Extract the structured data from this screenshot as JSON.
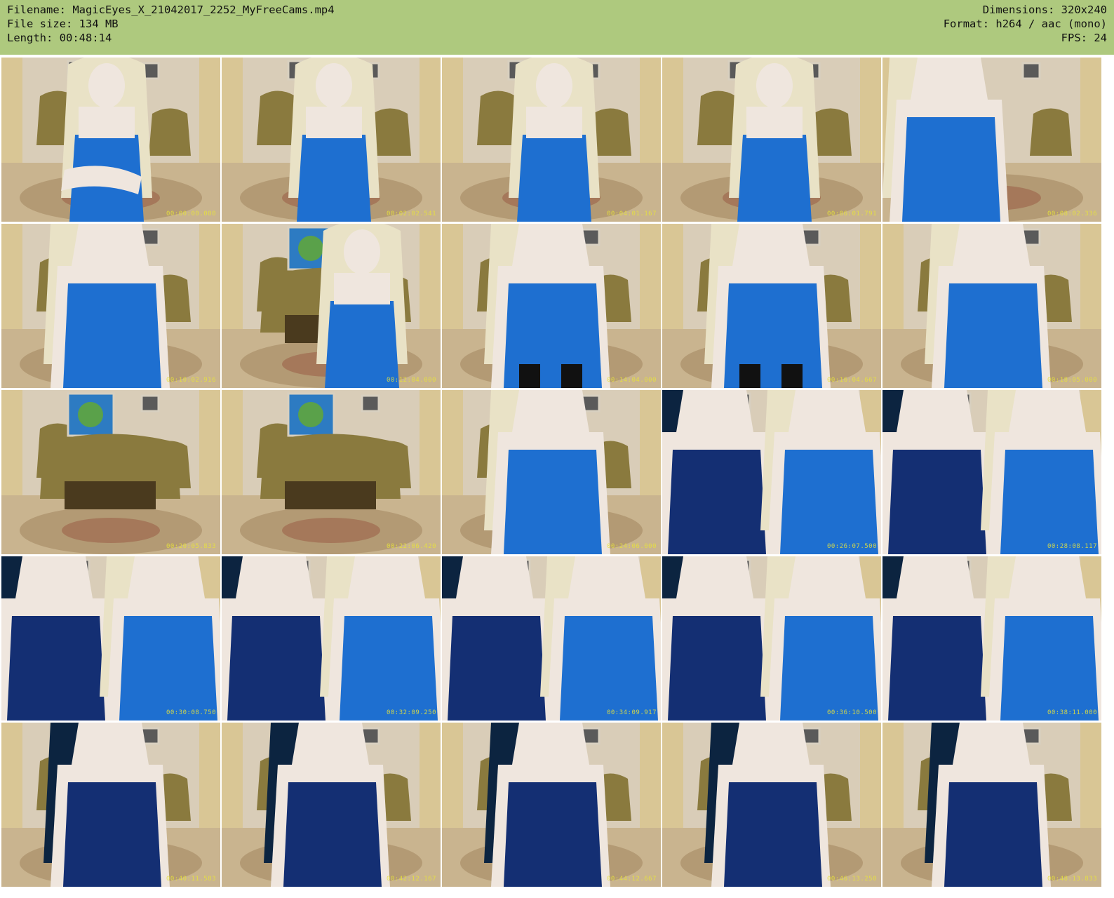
{
  "header": {
    "left": [
      "Filename: MagicEyes_X_21042017_2252_MyFreeCams.mp4",
      "File size: 134 MB",
      "Length: 00:48:14"
    ],
    "right": [
      "Dimensions: 320x240",
      "Format: h264 / aac (mono)",
      "FPS: 24"
    ],
    "background_color": "#aec97e"
  },
  "grid": {
    "columns": 5,
    "rows": 5,
    "frames": [
      {
        "kind": "blonde-arms",
        "timestamp": "00:00:00.000"
      },
      {
        "kind": "blonde",
        "timestamp": "00:02:02.541"
      },
      {
        "kind": "blonde-hair",
        "timestamp": "00:04:01.167"
      },
      {
        "kind": "blonde",
        "timestamp": "00:06:01.791"
      },
      {
        "kind": "blonde-side",
        "timestamp": "00:08:02.336"
      },
      {
        "kind": "blonde-close",
        "timestamp": "00:10:02.916"
      },
      {
        "kind": "blonde-sofa",
        "timestamp": "00:12:04.000"
      },
      {
        "kind": "blonde-stockings",
        "timestamp": "00:14:04.000"
      },
      {
        "kind": "blonde-stockings",
        "timestamp": "00:16:04.667"
      },
      {
        "kind": "blonde-close",
        "timestamp": "00:18:05.000"
      },
      {
        "kind": "empty-room",
        "timestamp": "00:20:05.833"
      },
      {
        "kind": "empty-room",
        "timestamp": "00:22:06.420"
      },
      {
        "kind": "blonde-close",
        "timestamp": "00:24:06.000"
      },
      {
        "kind": "duo",
        "timestamp": "00:26:07.500"
      },
      {
        "kind": "duo",
        "timestamp": "00:28:08.117"
      },
      {
        "kind": "duo",
        "timestamp": "00:30:08.750"
      },
      {
        "kind": "duo",
        "timestamp": "00:32:09.250"
      },
      {
        "kind": "duo-sit",
        "timestamp": "00:34:09.917"
      },
      {
        "kind": "duo-back",
        "timestamp": "00:36:10.500"
      },
      {
        "kind": "duo",
        "timestamp": "00:38:11.000"
      },
      {
        "kind": "brunette",
        "timestamp": "00:40:11.583"
      },
      {
        "kind": "brunette",
        "timestamp": "00:42:12.167"
      },
      {
        "kind": "brunette",
        "timestamp": "00:44:12.667"
      },
      {
        "kind": "brunette",
        "timestamp": "00:46:13.250"
      },
      {
        "kind": "brunette",
        "timestamp": "00:48:13.833"
      }
    ]
  },
  "colors": {
    "wall": "#d9cdb8",
    "curtain": "#d8c48c",
    "carpet": "#c9b48f",
    "carpet_pattern": "#9a7a55",
    "armchair": "#8a7a3e",
    "blue_top": "#1e6fd0",
    "navy_top": "#142f73",
    "blonde_hair": "#e9e2c6",
    "dark_hair": "#0c2440",
    "skin": "#efe6de"
  }
}
